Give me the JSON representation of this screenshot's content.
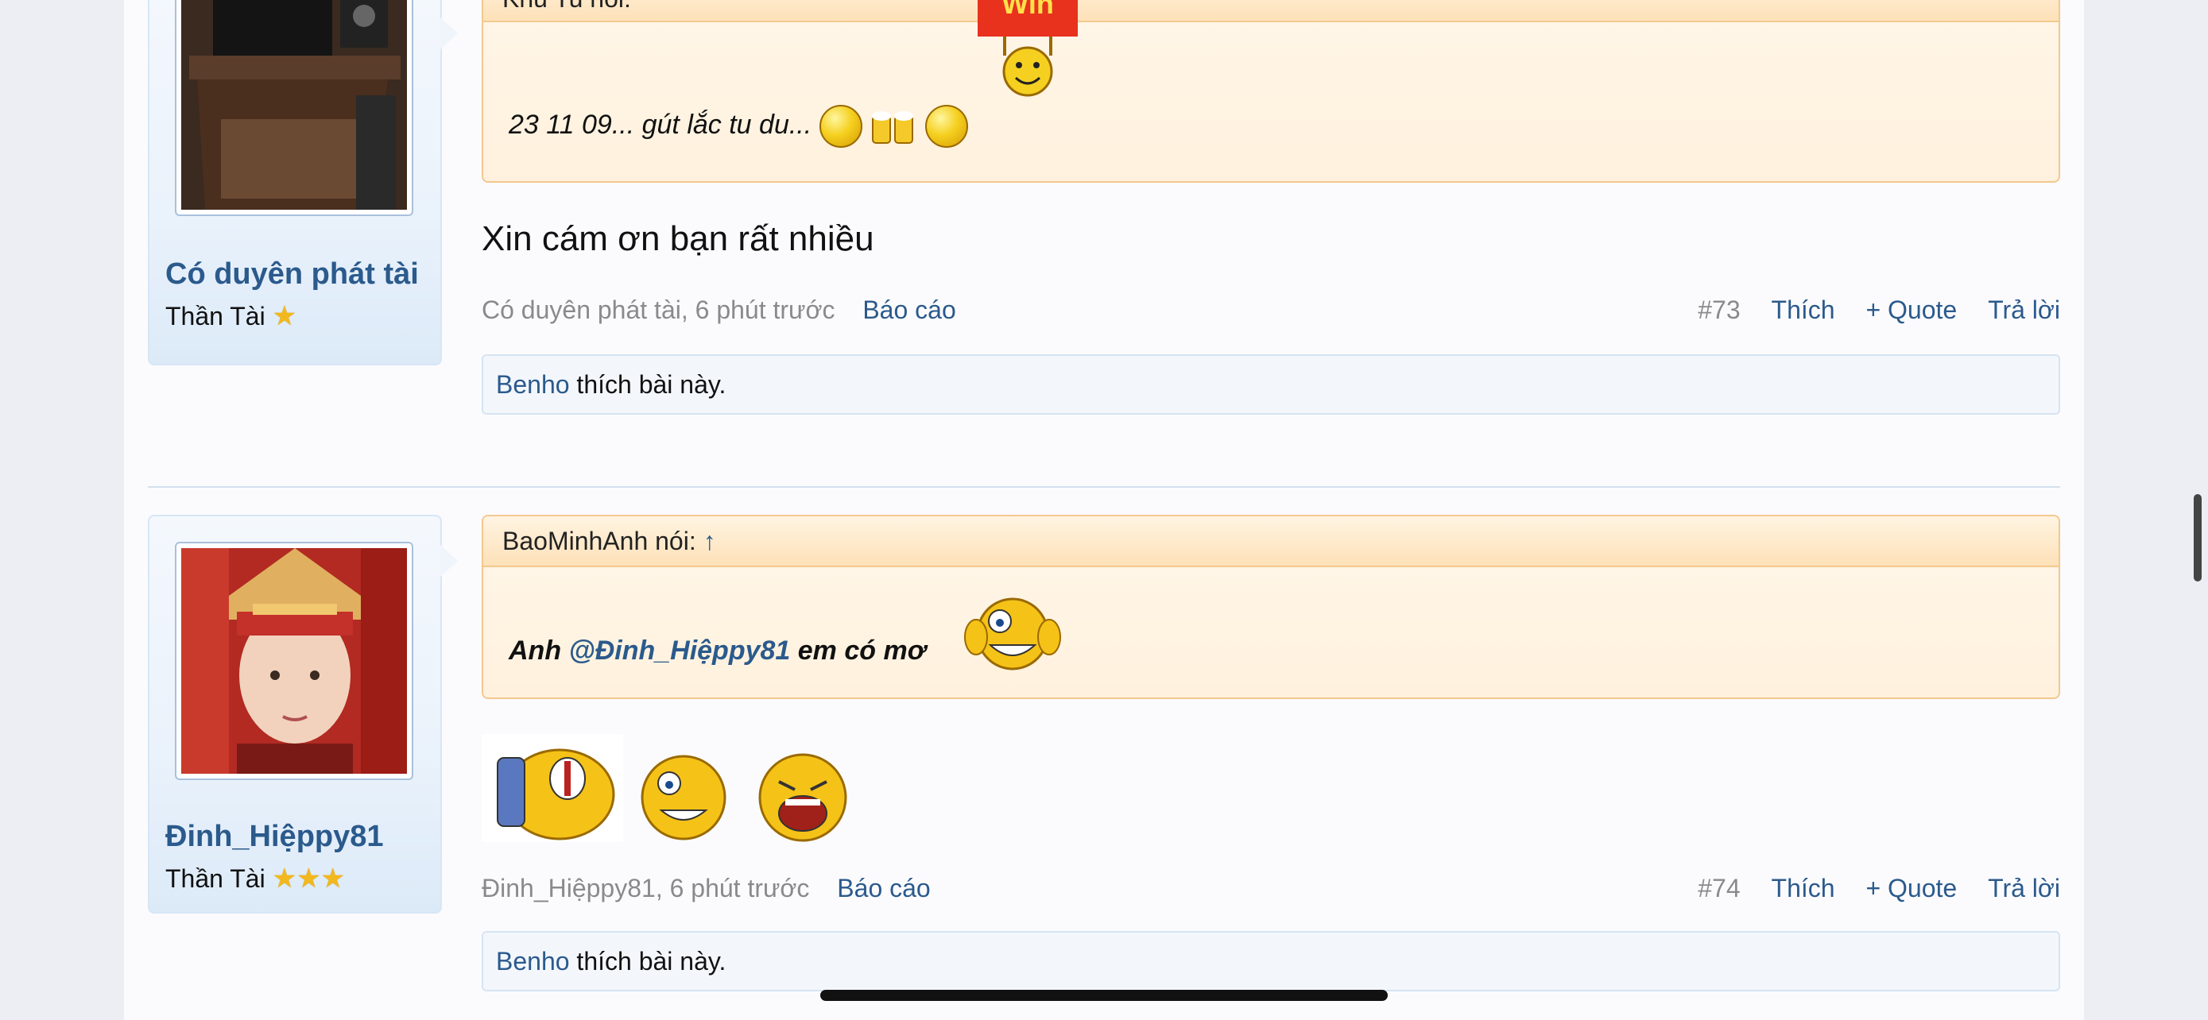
{
  "posts": [
    {
      "username": "Có duyên phát tài",
      "user_title": "Thần Tài",
      "stars": "★",
      "quote_author": "Khu Tu nói:",
      "quote_text": "23 11 09... gút lắc tu du...",
      "win_sign": "Win",
      "message": "Xin cám ơn bạn rất nhiều",
      "meta": {
        "author_time": "Có duyên phát tài, 6 phút trước",
        "report": "Báo cáo",
        "post_no": "#73",
        "like": "Thích",
        "quote": "+ Quote",
        "reply": "Trả lời"
      },
      "likes": {
        "who": "Benho",
        "text": " thích bài này."
      }
    },
    {
      "username": "Đinh_Hiệppy81",
      "user_title": "Thần Tài",
      "stars": "★★★",
      "quote_author": "BaoMinhAnh nói:",
      "quote_arrow": "↑",
      "quote_prefix": "Anh ",
      "quote_mention": "@Đinh_Hiệppy81",
      "quote_suffix": " em có mơ",
      "meta": {
        "author_time": "Đinh_Hiệppy81, 6 phút trước",
        "report": "Báo cáo",
        "post_no": "#74",
        "like": "Thích",
        "quote": "+ Quote",
        "reply": "Trả lời"
      },
      "likes": {
        "who": "Benho",
        "text": " thích bài này."
      }
    }
  ],
  "colors": {
    "link": "#2b5a8c",
    "quote_border": "#f3c88e",
    "page_bg": "#fbfbfe"
  }
}
